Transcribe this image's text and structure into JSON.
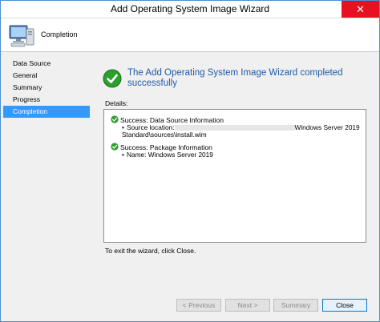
{
  "window": {
    "title": "Add Operating System Image Wizard",
    "close_symbol": "✕"
  },
  "header": {
    "heading": "Completion",
    "icon": "computer-icon"
  },
  "sidebar": {
    "items": [
      {
        "label": "Data Source",
        "active": false
      },
      {
        "label": "General",
        "active": false
      },
      {
        "label": "Summary",
        "active": false
      },
      {
        "label": "Progress",
        "active": false
      },
      {
        "label": "Completion",
        "active": true
      }
    ]
  },
  "main": {
    "headline": "The Add Operating System Image Wizard completed successfully",
    "details_label": "Details:",
    "entries": [
      {
        "head": "Success: Data Source Information",
        "lines": [
          "Source location:",
          "Windows Server 2019",
          "Standard\\sources\\install.wim"
        ]
      },
      {
        "head": "Success: Package Information",
        "lines": [
          "Name: Windows Server 2019"
        ]
      }
    ],
    "exit_text": "To exit the wizard, click Close."
  },
  "footer": {
    "previous_label": "< Previous",
    "next_label": "Next >",
    "summary_label": "Summary",
    "close_label": "Close"
  },
  "colors": {
    "accent": "#3399ff",
    "headline": "#1e5aa8",
    "success": "#2e9e2e",
    "close_hover": "#e81123"
  }
}
